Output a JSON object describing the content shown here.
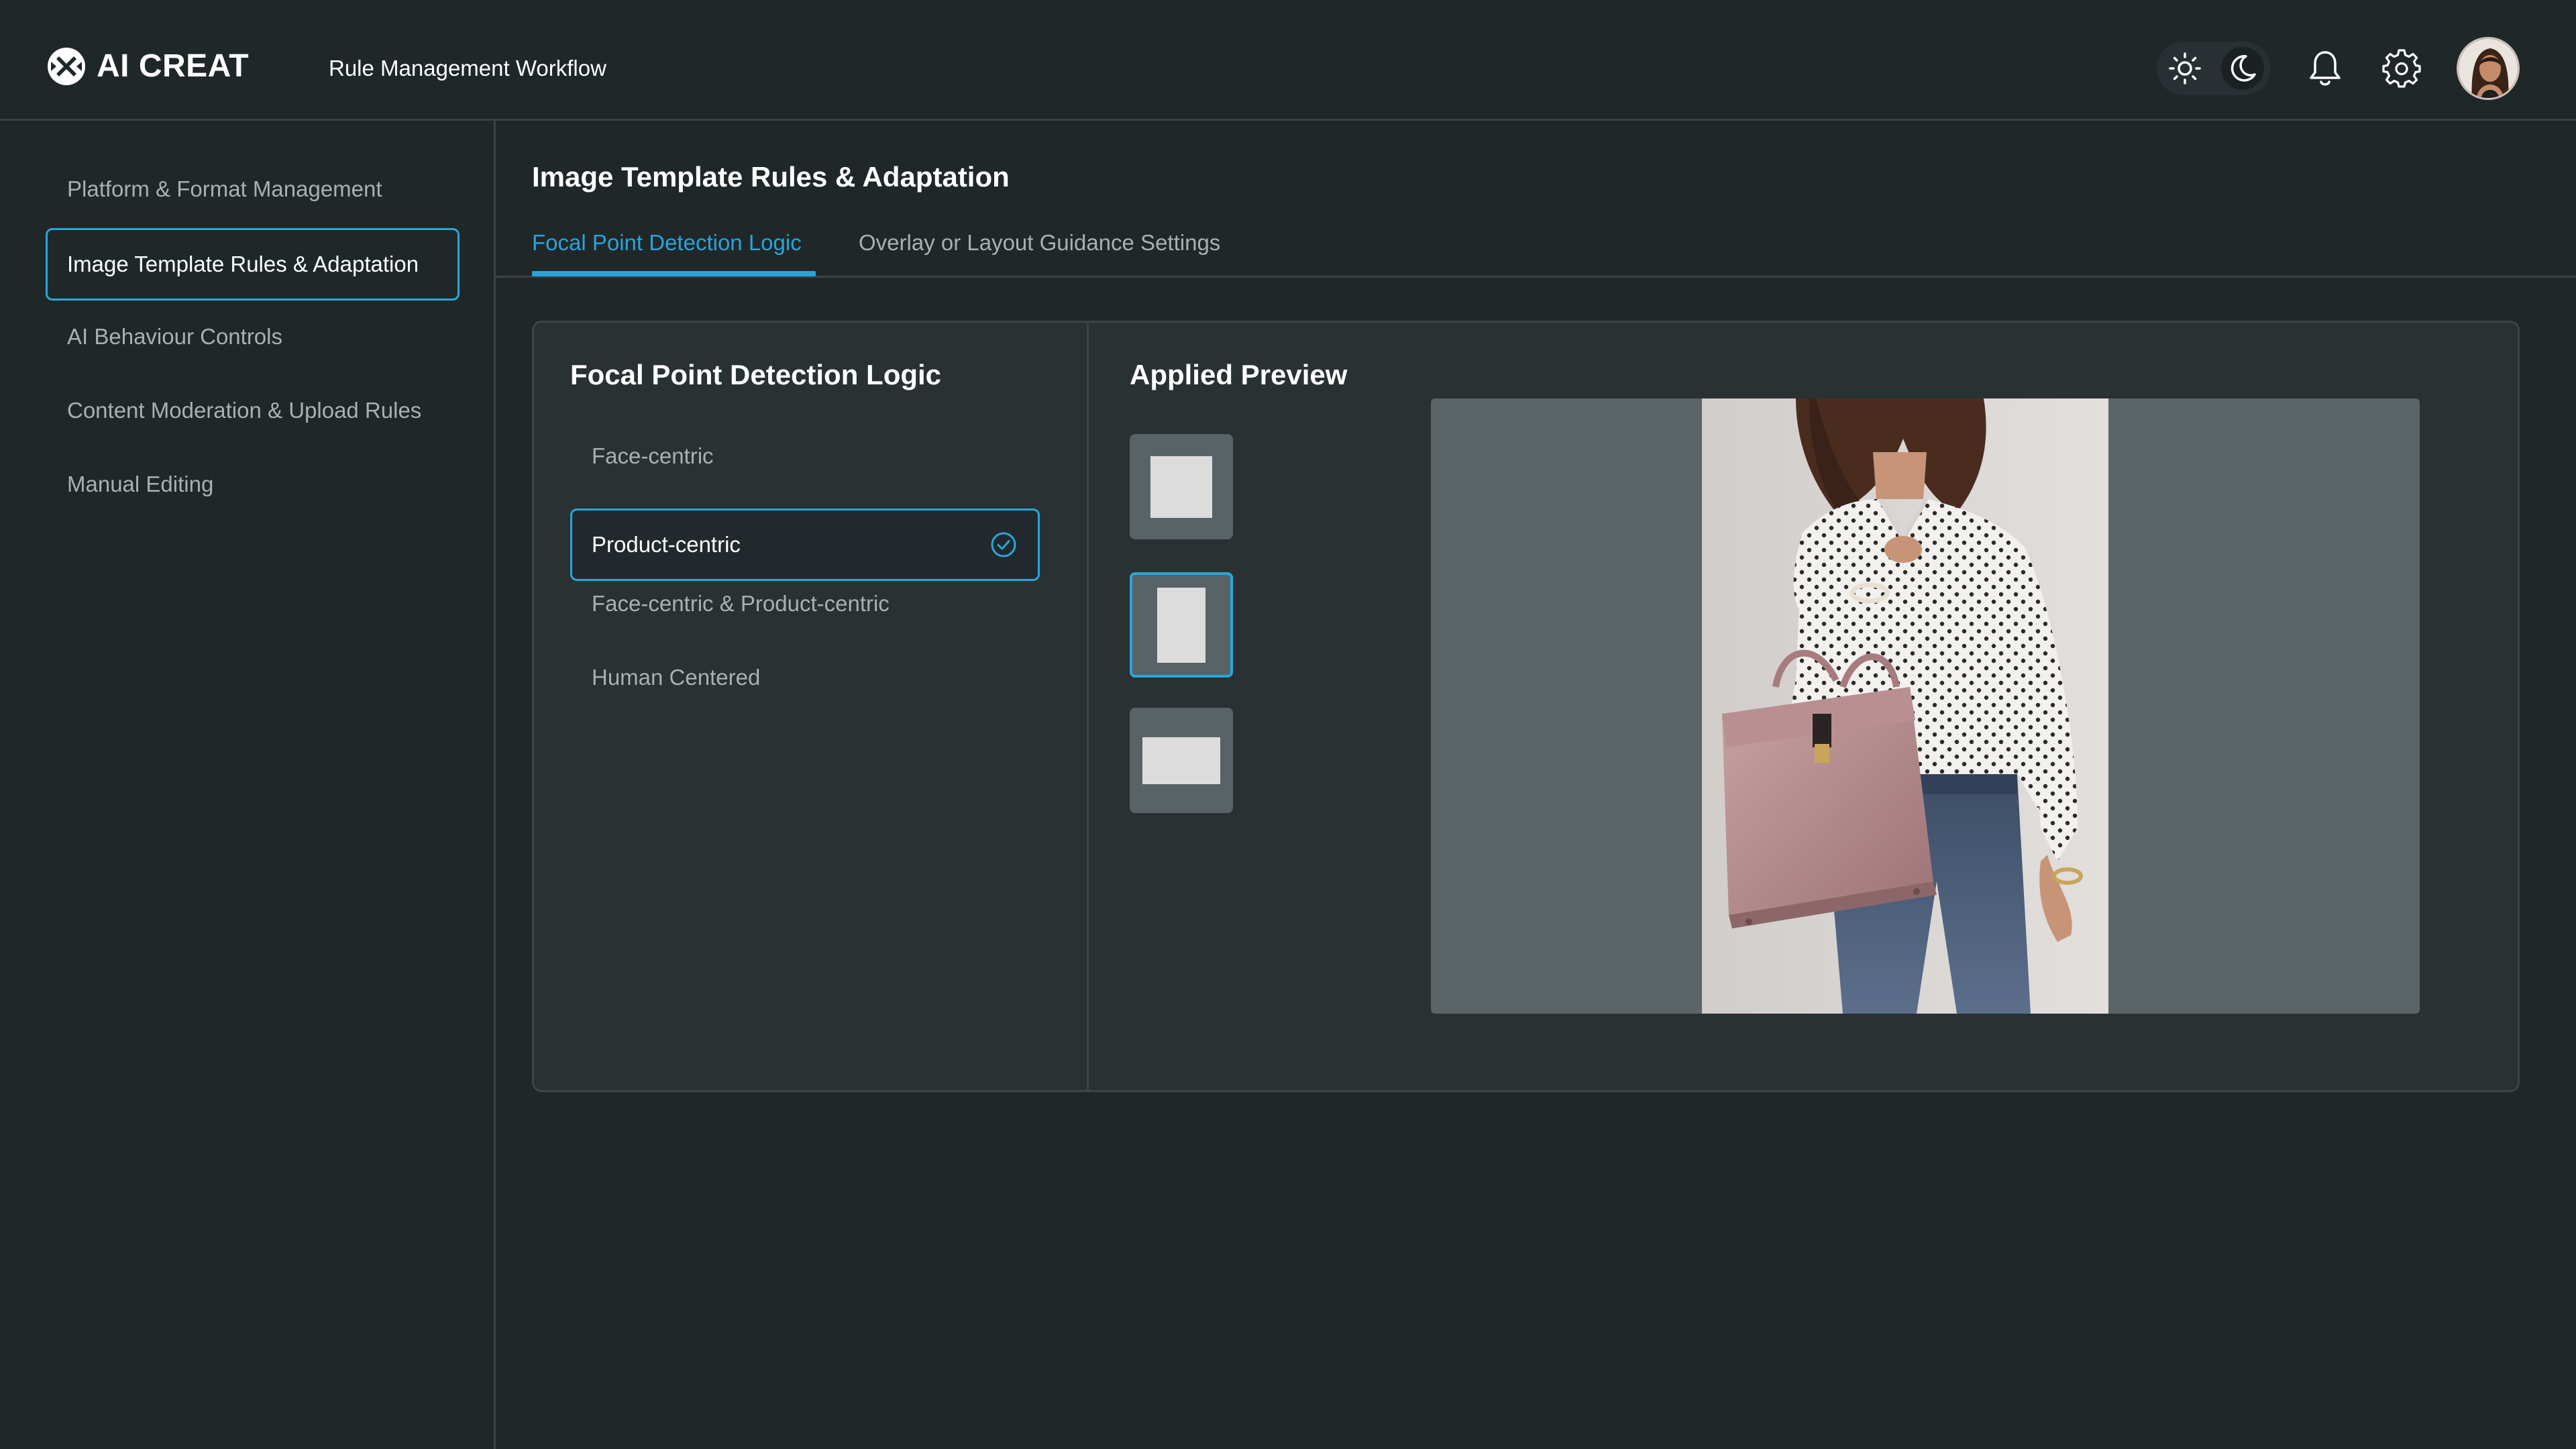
{
  "app": {
    "name": "AI CREAT",
    "workflow_title": "Rule Management Workflow"
  },
  "header": {
    "icons": [
      "logo-icon",
      "sun-icon",
      "moon-icon",
      "bell-icon",
      "gear-icon",
      "avatar"
    ],
    "theme": "dark"
  },
  "sidebar": {
    "items": [
      {
        "label": "Platform & Format Management",
        "active": false
      },
      {
        "label": "Image Template Rules & Adaptation",
        "active": true
      },
      {
        "label": "AI Behaviour Controls",
        "active": false
      },
      {
        "label": "Content Moderation & Upload Rules",
        "active": false
      },
      {
        "label": "Manual Editing",
        "active": false
      }
    ]
  },
  "main": {
    "title": "Image Template Rules & Adaptation",
    "tabs": [
      {
        "label": "Focal Point Detection Logic",
        "active": true
      },
      {
        "label": "Overlay or Layout Guidance Settings",
        "active": false
      }
    ],
    "focal_panel": {
      "title": "Focal Point Detection Logic",
      "options": [
        {
          "label": "Face-centric",
          "selected": false
        },
        {
          "label": "Product-centric",
          "selected": true
        },
        {
          "label": "Face-centric & Product-centric",
          "selected": false
        },
        {
          "label": "Human Centered",
          "selected": false
        }
      ]
    },
    "preview_panel": {
      "title": "Applied Preview",
      "ratios": [
        "square",
        "portrait",
        "landscape"
      ],
      "selected_ratio": "portrait"
    }
  },
  "colors": {
    "background": "#202729",
    "panel": "#293133",
    "accent": "#28a7d9",
    "muted_text": "#a9b0b3",
    "preview_bg": "#5b6466"
  }
}
